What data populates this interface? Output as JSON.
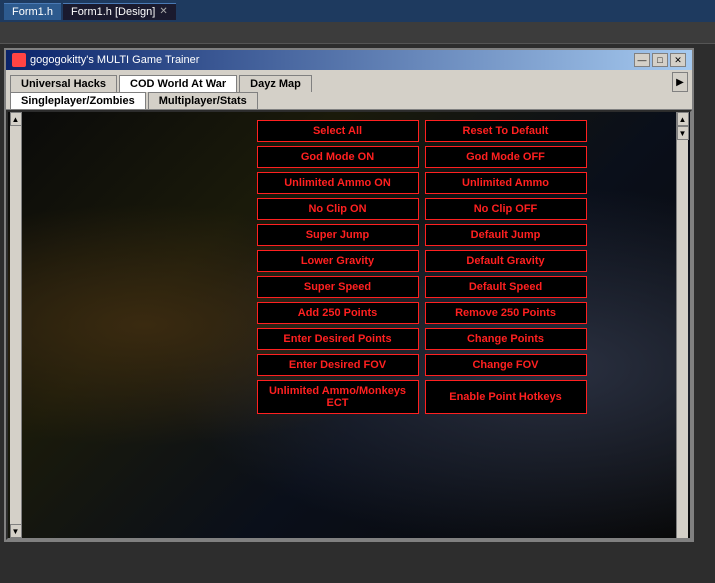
{
  "ide": {
    "tabs": [
      {
        "label": "Form1.h",
        "active": false
      },
      {
        "label": "Form1.h [Design]",
        "active": true,
        "closable": true
      }
    ],
    "toolbar": ""
  },
  "app": {
    "title": "gogogokitty's MULTI Game Trainer",
    "titlebar_buttons": [
      "—",
      "□",
      "✕"
    ],
    "tabs_row1": [
      {
        "label": "Universal Hacks",
        "active": false
      },
      {
        "label": "COD World At War",
        "active": true
      },
      {
        "label": "Dayz Map",
        "active": false
      }
    ],
    "tabs_row2": [
      {
        "label": "Singleplayer/Zombies",
        "active": true
      },
      {
        "label": "Multiplayer/Stats",
        "active": false
      }
    ],
    "buttons": [
      [
        {
          "label": "Select All",
          "wide": false
        },
        {
          "label": "Reset To Default",
          "wide": false
        }
      ],
      [
        {
          "label": "God Mode ON",
          "wide": false
        },
        {
          "label": "God Mode OFF",
          "wide": false
        }
      ],
      [
        {
          "label": "Unlimited Ammo ON",
          "wide": false
        },
        {
          "label": "Unlimited Ammo",
          "wide": false
        }
      ],
      [
        {
          "label": "No Clip ON",
          "wide": false
        },
        {
          "label": "No Clip OFF",
          "wide": false
        }
      ],
      [
        {
          "label": "Super Jump",
          "wide": false
        },
        {
          "label": "Default Jump",
          "wide": false
        }
      ],
      [
        {
          "label": "Lower Gravity",
          "wide": false
        },
        {
          "label": "Default Gravity",
          "wide": false
        }
      ],
      [
        {
          "label": "Super Speed",
          "wide": false
        },
        {
          "label": "Default Speed",
          "wide": false
        }
      ],
      [
        {
          "label": "Add 250 Points",
          "wide": false
        },
        {
          "label": "Remove 250 Points",
          "wide": false
        }
      ],
      [
        {
          "label": "Enter Desired Points",
          "wide": false
        },
        {
          "label": "Change Points",
          "wide": false
        }
      ],
      [
        {
          "label": "Enter Desired FOV",
          "wide": false
        },
        {
          "label": "Change FOV",
          "wide": false
        }
      ],
      [
        {
          "label": "Unlimited Ammo/Monkeys ECT",
          "wide": false
        },
        {
          "label": "Enable Point Hotkeys",
          "wide": false
        }
      ]
    ]
  }
}
